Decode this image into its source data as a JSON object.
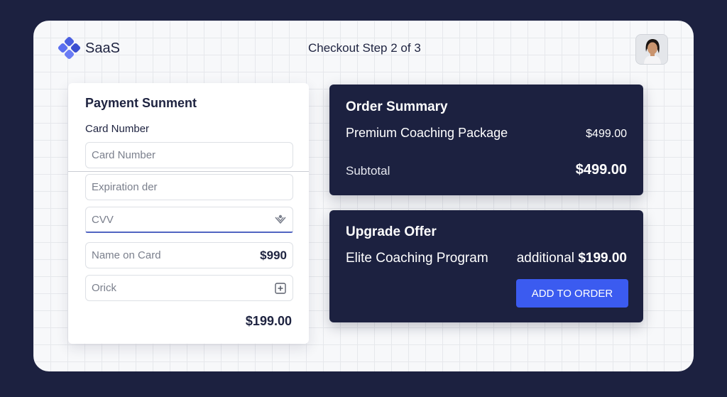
{
  "header": {
    "brand": "SaaS",
    "step_title": "Checkout Step 2 of 3"
  },
  "payment": {
    "title": "Payment Sunment",
    "card_label": "Card Number",
    "fields": {
      "card_number": {
        "placeholder": "Card Number"
      },
      "expiration": {
        "placeholder": "Expiration der"
      },
      "cvv": {
        "placeholder": "CVV"
      },
      "name_on_card": {
        "placeholder": "Name on Card",
        "value": "$990"
      },
      "extra": {
        "placeholder": "Orick"
      }
    },
    "total": "$199.00"
  },
  "order_summary": {
    "title": "Order Summary",
    "item_name": "Premium Coaching Package",
    "item_price": "$499.00",
    "subtotal_label": "Subtotal",
    "subtotal_value": "$499.00"
  },
  "upgrade": {
    "title": "Upgrade Offer",
    "item_name": "Elite Coaching Program",
    "additional_label": "additional",
    "additional_price": "$199.00",
    "button_label": "ADD TO ORDER"
  },
  "colors": {
    "background": "#1c2140",
    "accent": "#3b5bf0",
    "focus": "#5164c2"
  }
}
